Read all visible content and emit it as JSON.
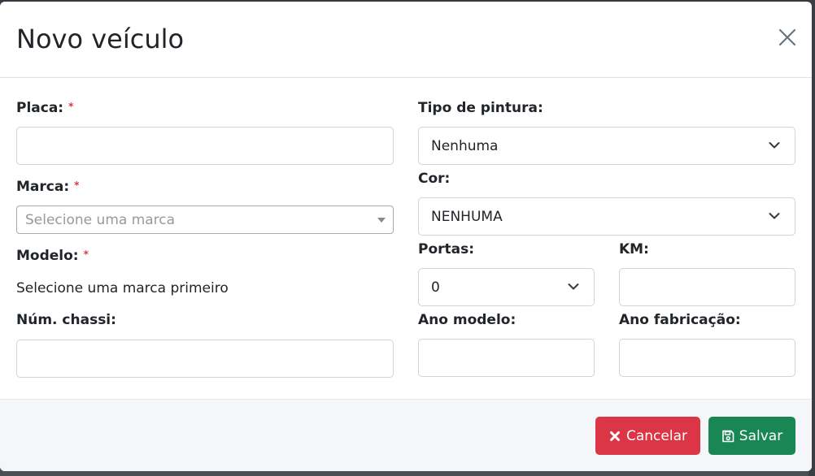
{
  "modal": {
    "title": "Novo veículo",
    "close_icon": "close-icon"
  },
  "form": {
    "required_mark": "*",
    "placa": {
      "label": "Placa:",
      "value": ""
    },
    "marca": {
      "label": "Marca:",
      "placeholder": "Selecione uma marca"
    },
    "modelo": {
      "label": "Modelo:",
      "helper": "Selecione uma marca primeiro"
    },
    "chassi": {
      "label": "Núm. chassi:",
      "value": ""
    },
    "tipo_pintura": {
      "label": "Tipo de pintura:",
      "selected": "Nenhuma"
    },
    "cor": {
      "label": "Cor:",
      "selected": "NENHUMA"
    },
    "portas": {
      "label": "Portas:",
      "selected": "0"
    },
    "km": {
      "label": "KM:",
      "value": ""
    },
    "ano_modelo": {
      "label": "Ano modelo:",
      "value": ""
    },
    "ano_fabricacao": {
      "label": "Ano fabricação:",
      "value": ""
    }
  },
  "footer": {
    "cancel_label": "Cancelar",
    "cancel_icon": "times-icon",
    "save_label": "Salvar",
    "save_icon": "floppy-disk-icon"
  },
  "colors": {
    "danger": "#dc3545",
    "success": "#198754",
    "required": "#dc3545"
  }
}
